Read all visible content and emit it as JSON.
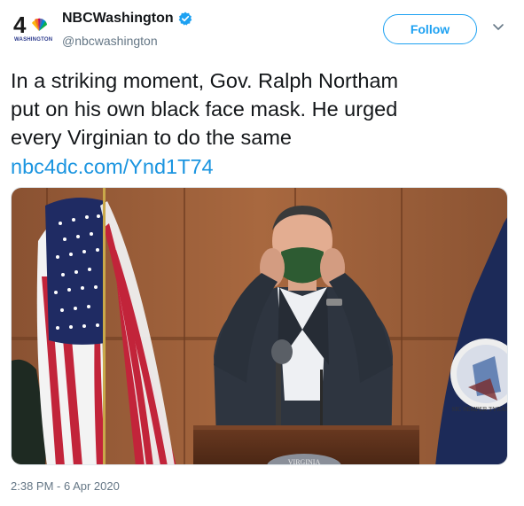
{
  "account": {
    "display_name": "NBCWashington",
    "handle": "@nbcwashington",
    "verified_icon": "verified-badge-icon",
    "avatar_number": "4",
    "avatar_caption": "WASHINGTON"
  },
  "actions": {
    "follow_label": "Follow",
    "menu_icon": "chevron-down-icon"
  },
  "tweet": {
    "text_lines": [
      "In a striking moment, Gov. Ralph Northam",
      "put on his own black face mask. He urged",
      "every Virginian to do the same"
    ],
    "link": "nbc4dc.com/Ynd1T74",
    "timestamp": "2:38 PM - 6 Apr 2020"
  },
  "media": {
    "seal_text": "SIC SEMPER TYRANNIS",
    "podium_text": "VIRGINIA"
  },
  "colors": {
    "brand_blue": "#1da1f2",
    "link_blue": "#1b95e0",
    "muted": "#657786"
  }
}
